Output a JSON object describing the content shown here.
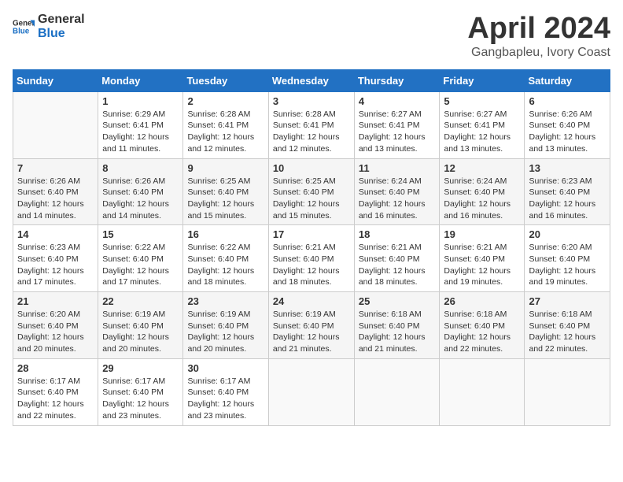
{
  "logo": {
    "line1": "General",
    "line2": "Blue"
  },
  "title": "April 2024",
  "location": "Gangbapleu, Ivory Coast",
  "days_of_week": [
    "Sunday",
    "Monday",
    "Tuesday",
    "Wednesday",
    "Thursday",
    "Friday",
    "Saturday"
  ],
  "weeks": [
    [
      {
        "day": "",
        "sunrise": "",
        "sunset": "",
        "daylight": ""
      },
      {
        "day": "1",
        "sunrise": "Sunrise: 6:29 AM",
        "sunset": "Sunset: 6:41 PM",
        "daylight": "Daylight: 12 hours and 11 minutes."
      },
      {
        "day": "2",
        "sunrise": "Sunrise: 6:28 AM",
        "sunset": "Sunset: 6:41 PM",
        "daylight": "Daylight: 12 hours and 12 minutes."
      },
      {
        "day": "3",
        "sunrise": "Sunrise: 6:28 AM",
        "sunset": "Sunset: 6:41 PM",
        "daylight": "Daylight: 12 hours and 12 minutes."
      },
      {
        "day": "4",
        "sunrise": "Sunrise: 6:27 AM",
        "sunset": "Sunset: 6:41 PM",
        "daylight": "Daylight: 12 hours and 13 minutes."
      },
      {
        "day": "5",
        "sunrise": "Sunrise: 6:27 AM",
        "sunset": "Sunset: 6:41 PM",
        "daylight": "Daylight: 12 hours and 13 minutes."
      },
      {
        "day": "6",
        "sunrise": "Sunrise: 6:26 AM",
        "sunset": "Sunset: 6:40 PM",
        "daylight": "Daylight: 12 hours and 13 minutes."
      }
    ],
    [
      {
        "day": "7",
        "sunrise": "Sunrise: 6:26 AM",
        "sunset": "Sunset: 6:40 PM",
        "daylight": "Daylight: 12 hours and 14 minutes."
      },
      {
        "day": "8",
        "sunrise": "Sunrise: 6:26 AM",
        "sunset": "Sunset: 6:40 PM",
        "daylight": "Daylight: 12 hours and 14 minutes."
      },
      {
        "day": "9",
        "sunrise": "Sunrise: 6:25 AM",
        "sunset": "Sunset: 6:40 PM",
        "daylight": "Daylight: 12 hours and 15 minutes."
      },
      {
        "day": "10",
        "sunrise": "Sunrise: 6:25 AM",
        "sunset": "Sunset: 6:40 PM",
        "daylight": "Daylight: 12 hours and 15 minutes."
      },
      {
        "day": "11",
        "sunrise": "Sunrise: 6:24 AM",
        "sunset": "Sunset: 6:40 PM",
        "daylight": "Daylight: 12 hours and 16 minutes."
      },
      {
        "day": "12",
        "sunrise": "Sunrise: 6:24 AM",
        "sunset": "Sunset: 6:40 PM",
        "daylight": "Daylight: 12 hours and 16 minutes."
      },
      {
        "day": "13",
        "sunrise": "Sunrise: 6:23 AM",
        "sunset": "Sunset: 6:40 PM",
        "daylight": "Daylight: 12 hours and 16 minutes."
      }
    ],
    [
      {
        "day": "14",
        "sunrise": "Sunrise: 6:23 AM",
        "sunset": "Sunset: 6:40 PM",
        "daylight": "Daylight: 12 hours and 17 minutes."
      },
      {
        "day": "15",
        "sunrise": "Sunrise: 6:22 AM",
        "sunset": "Sunset: 6:40 PM",
        "daylight": "Daylight: 12 hours and 17 minutes."
      },
      {
        "day": "16",
        "sunrise": "Sunrise: 6:22 AM",
        "sunset": "Sunset: 6:40 PM",
        "daylight": "Daylight: 12 hours and 18 minutes."
      },
      {
        "day": "17",
        "sunrise": "Sunrise: 6:21 AM",
        "sunset": "Sunset: 6:40 PM",
        "daylight": "Daylight: 12 hours and 18 minutes."
      },
      {
        "day": "18",
        "sunrise": "Sunrise: 6:21 AM",
        "sunset": "Sunset: 6:40 PM",
        "daylight": "Daylight: 12 hours and 18 minutes."
      },
      {
        "day": "19",
        "sunrise": "Sunrise: 6:21 AM",
        "sunset": "Sunset: 6:40 PM",
        "daylight": "Daylight: 12 hours and 19 minutes."
      },
      {
        "day": "20",
        "sunrise": "Sunrise: 6:20 AM",
        "sunset": "Sunset: 6:40 PM",
        "daylight": "Daylight: 12 hours and 19 minutes."
      }
    ],
    [
      {
        "day": "21",
        "sunrise": "Sunrise: 6:20 AM",
        "sunset": "Sunset: 6:40 PM",
        "daylight": "Daylight: 12 hours and 20 minutes."
      },
      {
        "day": "22",
        "sunrise": "Sunrise: 6:19 AM",
        "sunset": "Sunset: 6:40 PM",
        "daylight": "Daylight: 12 hours and 20 minutes."
      },
      {
        "day": "23",
        "sunrise": "Sunrise: 6:19 AM",
        "sunset": "Sunset: 6:40 PM",
        "daylight": "Daylight: 12 hours and 20 minutes."
      },
      {
        "day": "24",
        "sunrise": "Sunrise: 6:19 AM",
        "sunset": "Sunset: 6:40 PM",
        "daylight": "Daylight: 12 hours and 21 minutes."
      },
      {
        "day": "25",
        "sunrise": "Sunrise: 6:18 AM",
        "sunset": "Sunset: 6:40 PM",
        "daylight": "Daylight: 12 hours and 21 minutes."
      },
      {
        "day": "26",
        "sunrise": "Sunrise: 6:18 AM",
        "sunset": "Sunset: 6:40 PM",
        "daylight": "Daylight: 12 hours and 22 minutes."
      },
      {
        "day": "27",
        "sunrise": "Sunrise: 6:18 AM",
        "sunset": "Sunset: 6:40 PM",
        "daylight": "Daylight: 12 hours and 22 minutes."
      }
    ],
    [
      {
        "day": "28",
        "sunrise": "Sunrise: 6:17 AM",
        "sunset": "Sunset: 6:40 PM",
        "daylight": "Daylight: 12 hours and 22 minutes."
      },
      {
        "day": "29",
        "sunrise": "Sunrise: 6:17 AM",
        "sunset": "Sunset: 6:40 PM",
        "daylight": "Daylight: 12 hours and 23 minutes."
      },
      {
        "day": "30",
        "sunrise": "Sunrise: 6:17 AM",
        "sunset": "Sunset: 6:40 PM",
        "daylight": "Daylight: 12 hours and 23 minutes."
      },
      {
        "day": "",
        "sunrise": "",
        "sunset": "",
        "daylight": ""
      },
      {
        "day": "",
        "sunrise": "",
        "sunset": "",
        "daylight": ""
      },
      {
        "day": "",
        "sunrise": "",
        "sunset": "",
        "daylight": ""
      },
      {
        "day": "",
        "sunrise": "",
        "sunset": "",
        "daylight": ""
      }
    ]
  ]
}
